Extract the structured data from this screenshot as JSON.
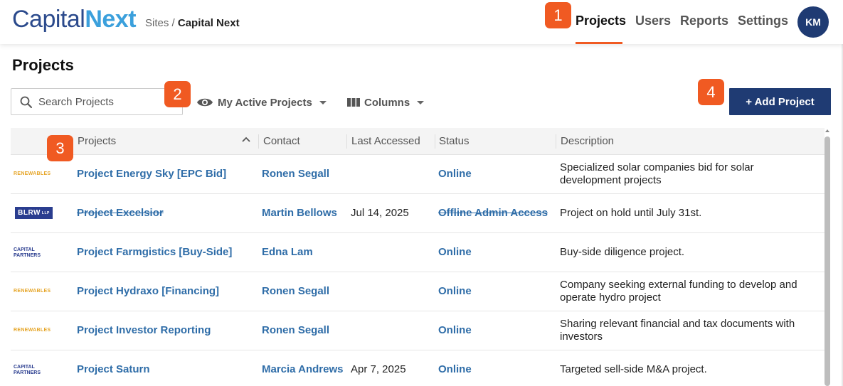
{
  "header": {
    "logo_part1": "Capital",
    "logo_part2": "Next",
    "breadcrumb_root": "Sites",
    "breadcrumb_sep": "/",
    "breadcrumb_current": "Capital Next",
    "nav": [
      {
        "label": "Projects",
        "active": true
      },
      {
        "label": "Users",
        "active": false
      },
      {
        "label": "Reports",
        "active": false
      },
      {
        "label": "Settings",
        "active": false
      }
    ],
    "avatar_initials": "KM"
  },
  "callouts": [
    "1",
    "2",
    "3",
    "4"
  ],
  "page": {
    "title": "Projects",
    "search_placeholder": "Search Projects",
    "filter_label": "My Active Projects",
    "columns_label": "Columns",
    "add_button": "+ Add Project"
  },
  "table": {
    "headers": [
      "Projects",
      "Contact",
      "Last Accessed",
      "Status",
      "Description"
    ],
    "rows": [
      {
        "logo": "RENEWABLES",
        "project": "Project Energy Sky [EPC Bid]",
        "contact": "Ronen Segall",
        "last_accessed": "",
        "status": "Online",
        "description": "Specialized solar companies bid for solar development projects",
        "strike": false
      },
      {
        "logo": "BLRW",
        "logo_suffix": "LLP",
        "project": "Project Excelsior",
        "contact": "Martin Bellows",
        "last_accessed": "Jul 14, 2025",
        "status": "Offline Admin Access",
        "description": "Project on hold until July 31st.",
        "strike": true
      },
      {
        "logo": "CAPITAL PARTNERS",
        "project": "Project Farmgistics [Buy-Side]",
        "contact": "Edna Lam",
        "last_accessed": "",
        "status": "Online",
        "description": "Buy-side diligence project.",
        "strike": false
      },
      {
        "logo": "RENEWABLES",
        "project": "Project Hydraxo [Financing]",
        "contact": "Ronen Segall",
        "last_accessed": "",
        "status": "Online",
        "description": "Company seeking external funding to develop and operate hydro project",
        "strike": false
      },
      {
        "logo": "RENEWABLES",
        "project": "Project Investor Reporting",
        "contact": "Ronen Segall",
        "last_accessed": "",
        "status": "Online",
        "description": "Sharing relevant financial and tax documents with investors",
        "strike": false
      },
      {
        "logo": "CAPITAL PARTNERS",
        "project": "Project Saturn",
        "contact": "Marcia Andrews",
        "last_accessed": "Apr 7, 2025",
        "status": "Online",
        "description": "Targeted sell-side M&A project.",
        "strike": false
      }
    ]
  },
  "colors": {
    "accent": "#f05a22",
    "primary": "#1f3b73",
    "link": "#2f6da8"
  }
}
